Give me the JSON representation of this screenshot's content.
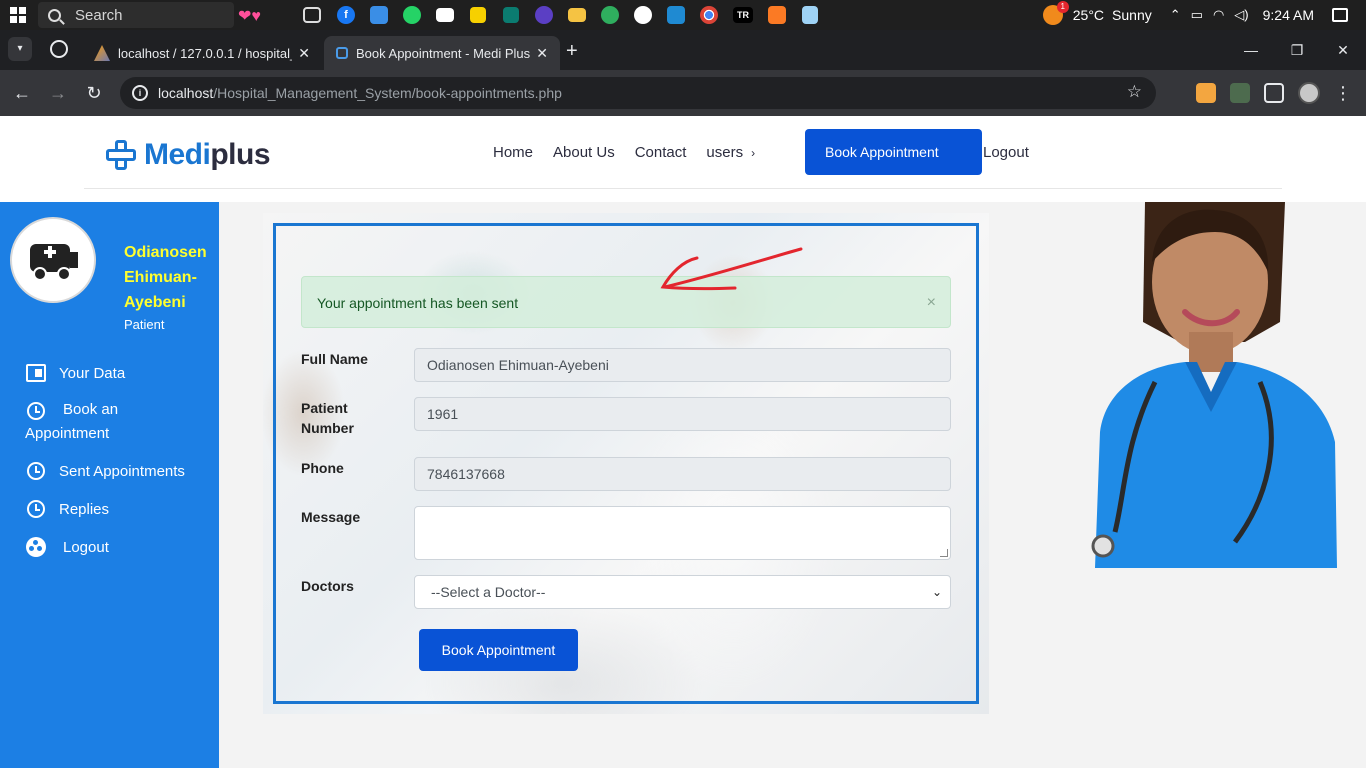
{
  "taskbar": {
    "search_placeholder": "Search",
    "weather_temp": "25°C",
    "weather_desc": "Sunny",
    "weather_badge": "1",
    "time": "9:24 AM"
  },
  "browser": {
    "tabs": [
      {
        "title": "localhost / 127.0.0.1 / hospital_"
      },
      {
        "title": "Book Appointment - Medi Plus"
      }
    ],
    "url_host": "localhost",
    "url_path": "/Hospital_Management_System/book-appointments.php"
  },
  "site": {
    "logo_prefix": "Medi",
    "logo_suffix": "plus",
    "nav": {
      "home": "Home",
      "about": "About Us",
      "contact": "Contact",
      "users": "users"
    },
    "header_button": "Book Appointment",
    "logout": "Logout"
  },
  "sidebar": {
    "user_name": "Odianosen Ehimuan-Ayebeni",
    "user_role": "Patient",
    "items": [
      {
        "label": "Your Data"
      },
      {
        "label": "Book an Appointment"
      },
      {
        "label": "Sent Appointments"
      },
      {
        "label": "Replies"
      },
      {
        "label": "Logout"
      }
    ]
  },
  "form": {
    "alert": "Your appointment has been sent",
    "labels": {
      "full_name": "Full Name",
      "patient_number": "Patient Number",
      "phone": "Phone",
      "message": "Message",
      "doctors": "Doctors"
    },
    "values": {
      "full_name": "Odianosen Ehimuan-Ayebeni",
      "patient_number": "1961",
      "phone": "7846137668",
      "message": ""
    },
    "doctor_select": "--Select a Doctor--",
    "submit": "Book Appointment"
  },
  "colors": {
    "brand": "#1a76d1",
    "button": "#0953d6",
    "sidebar": "#1c7fe4",
    "user_name": "#ffff2e",
    "alert_bg": "#d4edda"
  }
}
